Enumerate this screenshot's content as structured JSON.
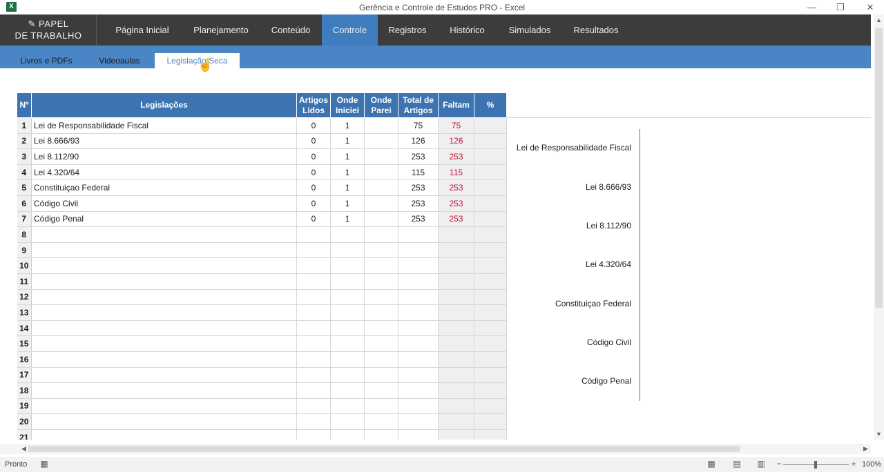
{
  "window": {
    "title": "Gerência e Controle de Estudos PRO - Excel",
    "app_icon": "X",
    "minimize": "—",
    "restore": "❐",
    "close": "✕"
  },
  "logo": {
    "line1": "PAPEL",
    "line2": "DE TRABALHO",
    "icon": "✎"
  },
  "nav": {
    "items": [
      "Página Inicial",
      "Planejamento",
      "Conteúdo",
      "Controle",
      "Registros",
      "Histórico",
      "Simulados",
      "Resultados"
    ],
    "active": "Controle"
  },
  "subnav": {
    "items": [
      "Livros e PDFs",
      "Videoaulas",
      "Legislação Seca"
    ],
    "active": "Legislação Seca"
  },
  "table": {
    "headers": {
      "num": "Nº",
      "name": "Legislações",
      "lidos_1": "Artigos",
      "lidos_2": "Lidos",
      "iniciei_1": "Onde",
      "iniciei_2": "Iniciei",
      "parei_1": "Onde",
      "parei_2": "Parei",
      "total_1": "Total de",
      "total_2": "Artigos",
      "faltam": "Faltam",
      "pct": "%"
    },
    "rows": [
      {
        "n": "1",
        "name": "Lei de Responsabilidade Fiscal",
        "lidos": "0",
        "iniciei": "1",
        "parei": "",
        "total": "75",
        "faltam": "75",
        "pct": ""
      },
      {
        "n": "2",
        "name": "Lei 8.666/93",
        "lidos": "0",
        "iniciei": "1",
        "parei": "",
        "total": "126",
        "faltam": "126",
        "pct": ""
      },
      {
        "n": "3",
        "name": "Lei 8.112/90",
        "lidos": "0",
        "iniciei": "1",
        "parei": "",
        "total": "253",
        "faltam": "253",
        "pct": ""
      },
      {
        "n": "4",
        "name": "Lei 4.320/64",
        "lidos": "0",
        "iniciei": "1",
        "parei": "",
        "total": "115",
        "faltam": "115",
        "pct": ""
      },
      {
        "n": "5",
        "name": "Constituiçao Federal",
        "lidos": "0",
        "iniciei": "1",
        "parei": "",
        "total": "253",
        "faltam": "253",
        "pct": ""
      },
      {
        "n": "6",
        "name": "Código Civil",
        "lidos": "0",
        "iniciei": "1",
        "parei": "",
        "total": "253",
        "faltam": "253",
        "pct": ""
      },
      {
        "n": "7",
        "name": "Código Penal",
        "lidos": "0",
        "iniciei": "1",
        "parei": "",
        "total": "253",
        "faltam": "253",
        "pct": ""
      },
      {
        "n": "8",
        "name": "",
        "lidos": "",
        "iniciei": "",
        "parei": "",
        "total": "",
        "faltam": "",
        "pct": ""
      },
      {
        "n": "9",
        "name": "",
        "lidos": "",
        "iniciei": "",
        "parei": "",
        "total": "",
        "faltam": "",
        "pct": ""
      },
      {
        "n": "10",
        "name": "",
        "lidos": "",
        "iniciei": "",
        "parei": "",
        "total": "",
        "faltam": "",
        "pct": ""
      },
      {
        "n": "11",
        "name": "",
        "lidos": "",
        "iniciei": "",
        "parei": "",
        "total": "",
        "faltam": "",
        "pct": ""
      },
      {
        "n": "12",
        "name": "",
        "lidos": "",
        "iniciei": "",
        "parei": "",
        "total": "",
        "faltam": "",
        "pct": ""
      },
      {
        "n": "13",
        "name": "",
        "lidos": "",
        "iniciei": "",
        "parei": "",
        "total": "",
        "faltam": "",
        "pct": ""
      },
      {
        "n": "14",
        "name": "",
        "lidos": "",
        "iniciei": "",
        "parei": "",
        "total": "",
        "faltam": "",
        "pct": ""
      },
      {
        "n": "15",
        "name": "",
        "lidos": "",
        "iniciei": "",
        "parei": "",
        "total": "",
        "faltam": "",
        "pct": ""
      },
      {
        "n": "16",
        "name": "",
        "lidos": "",
        "iniciei": "",
        "parei": "",
        "total": "",
        "faltam": "",
        "pct": ""
      },
      {
        "n": "17",
        "name": "",
        "lidos": "",
        "iniciei": "",
        "parei": "",
        "total": "",
        "faltam": "",
        "pct": ""
      },
      {
        "n": "18",
        "name": "",
        "lidos": "",
        "iniciei": "",
        "parei": "",
        "total": "",
        "faltam": "",
        "pct": ""
      },
      {
        "n": "19",
        "name": "",
        "lidos": "",
        "iniciei": "",
        "parei": "",
        "total": "",
        "faltam": "",
        "pct": ""
      },
      {
        "n": "20",
        "name": "",
        "lidos": "",
        "iniciei": "",
        "parei": "",
        "total": "",
        "faltam": "",
        "pct": ""
      },
      {
        "n": "21",
        "name": "",
        "lidos": "",
        "iniciei": "",
        "parei": "",
        "total": "",
        "faltam": "",
        "pct": ""
      }
    ]
  },
  "chart": {
    "labels": [
      "Lei de Responsabilidade Fiscal",
      "Lei 8.666/93",
      "Lei 8.112/90",
      "Lei 4.320/64",
      "Constituiçao Federal",
      "Código Civil",
      "Código Penal"
    ]
  },
  "status": {
    "ready": "Pronto",
    "zoom": "100%",
    "zoom_minus": "−",
    "zoom_plus": "+"
  },
  "colors": {
    "nav_bg": "#3c3c3c",
    "nav_active": "#3f7dbf",
    "subnav_bg": "#4a86c5",
    "header_blue": "#3d73b0",
    "faltam_red": "#c0143c"
  }
}
